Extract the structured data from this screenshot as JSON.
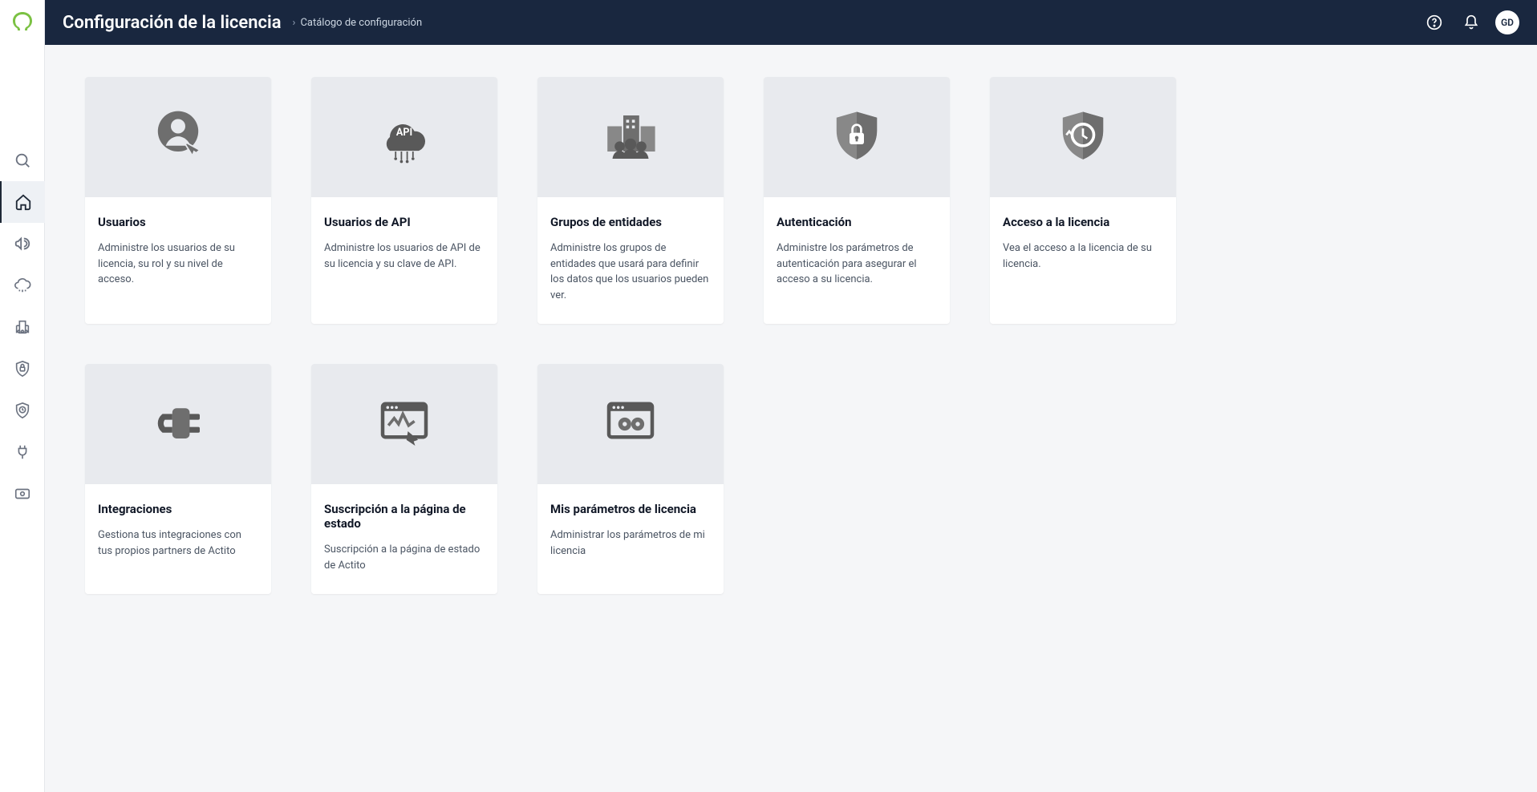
{
  "header": {
    "title": "Configuración de la licencia",
    "breadcrumb": "Catálogo de configuración"
  },
  "user": {
    "initials": "GD"
  },
  "cards": [
    {
      "title": "Usuarios",
      "desc": "Administre los usuarios de su licencia, su rol y su nivel de acceso.",
      "icon": "users-icon"
    },
    {
      "title": "Usuarios de API",
      "desc": "Administre los usuarios de API de su licencia y su clave de API.",
      "icon": "api-icon"
    },
    {
      "title": "Grupos de entidades",
      "desc": "Administre los grupos de entidades que usará para definir los datos que los usuarios pueden ver.",
      "icon": "entities-icon"
    },
    {
      "title": "Autenticación",
      "desc": "Administre los parámetros de autenticación para asegurar el acceso a su licencia.",
      "icon": "shield-lock-icon"
    },
    {
      "title": "Acceso a la licencia",
      "desc": "Vea el acceso a la licencia de su licencia.",
      "icon": "shield-history-icon"
    },
    {
      "title": "Integraciones",
      "desc": "Gestiona tus integraciones con tus propios partners de Actito",
      "icon": "plug-icon"
    },
    {
      "title": "Suscripción a la página de estado",
      "desc": "Suscripción a la página de estado de Actito",
      "icon": "status-page-icon"
    },
    {
      "title": "Mis parámetros de licencia",
      "desc": "Administrar los parámetros de mi licencia",
      "icon": "params-icon"
    }
  ]
}
